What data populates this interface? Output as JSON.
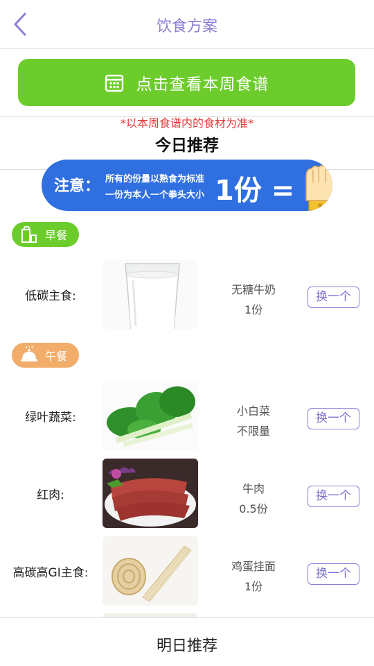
{
  "header": {
    "title": "饮食方案",
    "back_icon": "chevron-left-icon"
  },
  "week_button": {
    "label": "点击查看本周食谱",
    "icon": "calendar-icon"
  },
  "notice": "*以本周食谱内的食材为准*",
  "section_title": "今日推荐",
  "banner": {
    "label": "注意：",
    "line1": "所有的份量以熟食为标准",
    "line2": "一份为本人一个拳头大小",
    "portion": "1份 =",
    "icon": "fist-icon"
  },
  "meals": {
    "breakfast": {
      "label": "早餐",
      "icon": "milk-icon",
      "color": "#6ccc2c"
    },
    "lunch": {
      "label": "午餐",
      "icon": "cloche-icon",
      "color": "#f2ad6b"
    }
  },
  "foods": [
    {
      "category": "低碳主食:",
      "name": "无糖牛奶",
      "amount": "1份",
      "swap": "换一个",
      "image": "milk-glass"
    },
    {
      "category": "绿叶蔬菜:",
      "name": "小白菜",
      "amount": "不限量",
      "swap": "换一个",
      "image": "bok-choy"
    },
    {
      "category": "红肉:",
      "name": "牛肉",
      "amount": "0.5份",
      "swap": "换一个",
      "image": "sliced-beef"
    },
    {
      "category": "高碳高GI主食:",
      "name": "鸡蛋挂面",
      "amount": "1份",
      "swap": "换一个",
      "image": "egg-noodles"
    }
  ],
  "bottom": {
    "label": "明日推荐"
  },
  "colors": {
    "accent": "#8a7fd6",
    "green": "#6ccc2c",
    "orange": "#f2ad6b",
    "banner_blue": "#2f6fe0",
    "notice_red": "#e23b3b"
  }
}
